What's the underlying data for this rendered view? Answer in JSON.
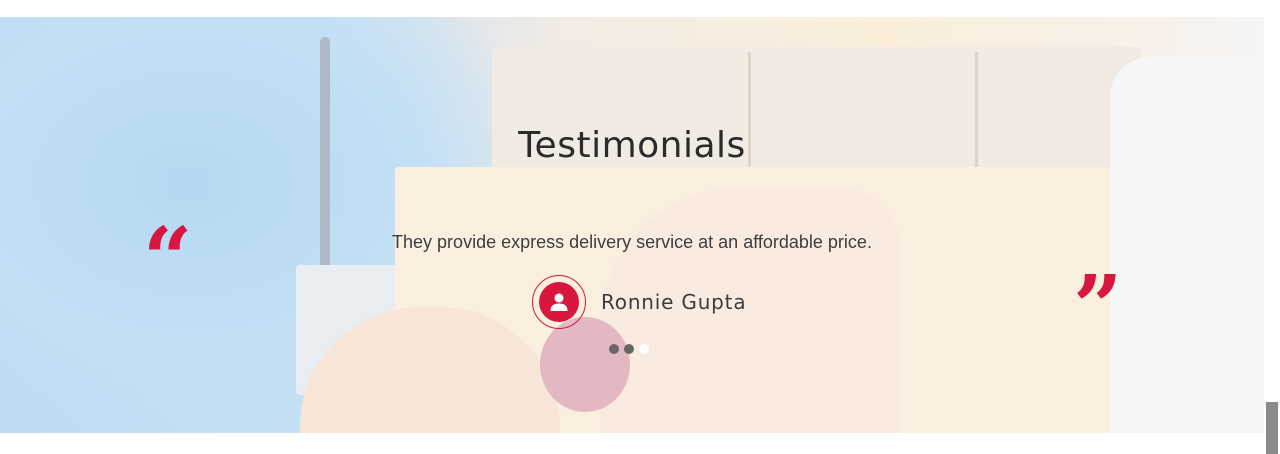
{
  "testimonials": {
    "title": "Testimonials",
    "quote_text": "They provide express delivery service at an affordable price.",
    "author_name": "Ronnie Gupta",
    "slide_count": 3,
    "active_slide": 3,
    "icons": {
      "open_quote": "open-quote-icon",
      "close_quote": "close-quote-icon",
      "avatar": "user-avatar-icon"
    },
    "colors": {
      "accent": "#d8173f",
      "text": "#3d3d3d",
      "dot_inactive": "#666666",
      "dot_active": "#ffffff"
    }
  },
  "glyphs": {
    "open_quote": "“",
    "close_quote": "”"
  }
}
